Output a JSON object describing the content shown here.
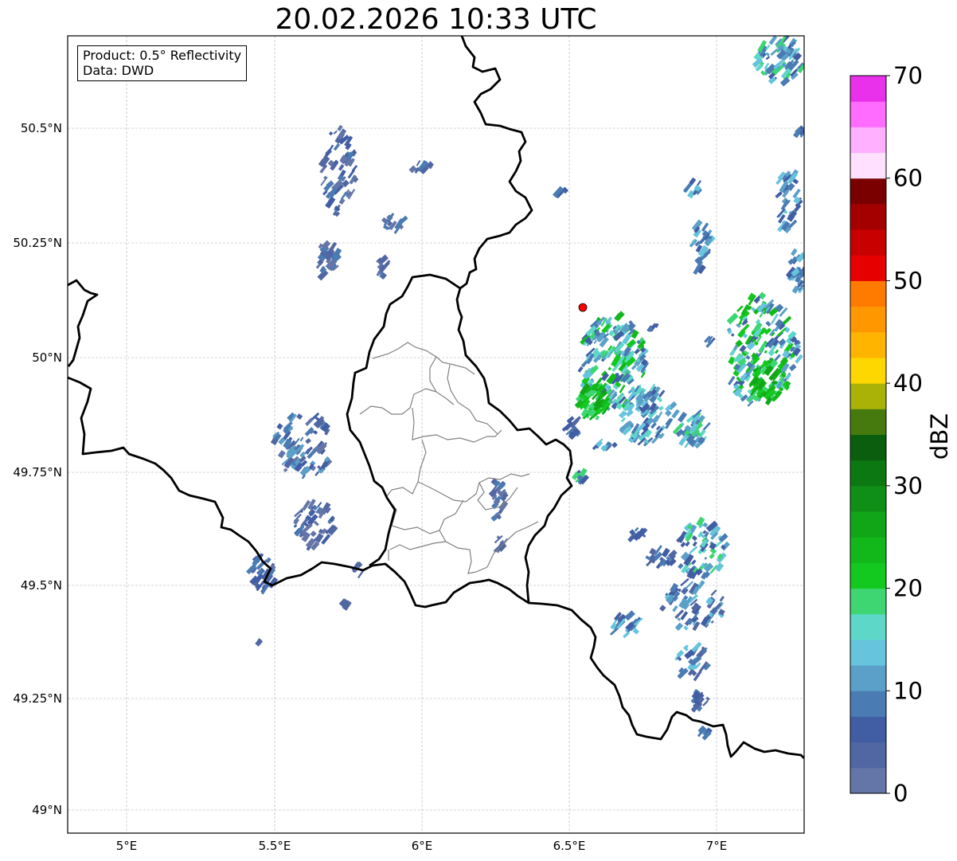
{
  "title": "20.02.2026 10:33 UTC",
  "info_box": {
    "product": "Product: 0.5° Reflectivity",
    "data": "Data: DWD"
  },
  "axes": {
    "lon_ticks": [
      "5°E",
      "5.5°E",
      "6°E",
      "6.5°E",
      "7°E"
    ],
    "lat_ticks": [
      "50.5°N",
      "50.25°N",
      "50°N",
      "49.75°N",
      "49.5°N",
      "49.25°N",
      "49°N"
    ]
  },
  "colorbar": {
    "label": "dBZ",
    "ticks": [
      "0",
      "10",
      "20",
      "30",
      "40",
      "50",
      "60",
      "70"
    ],
    "levels": [
      0,
      2.5,
      5,
      7.5,
      10,
      12.5,
      15,
      17.5,
      20,
      22.5,
      25,
      27.5,
      30,
      32.5,
      35,
      37.5,
      40,
      42.5,
      45,
      47.5,
      50,
      52.5,
      55,
      57.5,
      60,
      62.5,
      65,
      67.5,
      70
    ],
    "colors": [
      "#6475a8",
      "#5167a3",
      "#415da3",
      "#4a7bb3",
      "#5aa0c8",
      "#66c4dc",
      "#5dd8c8",
      "#3dd673",
      "#13c81e",
      "#12b81a",
      "#11a518",
      "#0f8f15",
      "#0c7812",
      "#0a5e0e",
      "#477a0e",
      "#aab208",
      "#ffd700",
      "#ffb400",
      "#ff9800",
      "#ff7b00",
      "#e60000",
      "#c80000",
      "#a50000",
      "#7a0000",
      "#ffe0ff",
      "#ffb0ff",
      "#ff6cff",
      "#e930ea"
    ]
  },
  "marker": {
    "name": "radar-site",
    "color": "#ff0000"
  },
  "colors": {
    "border": "#000000",
    "district": "#808080",
    "grid": "#b0b0b0"
  }
}
